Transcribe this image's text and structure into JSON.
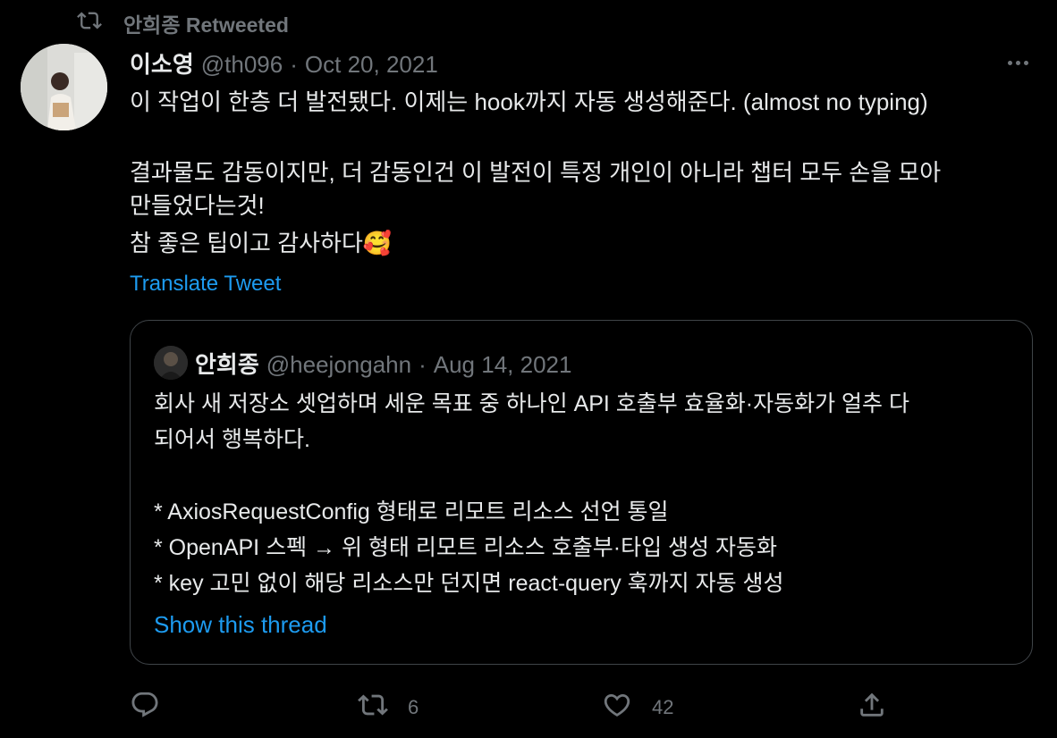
{
  "retweet_context": {
    "label": "안희종 Retweeted",
    "icon": "retweet-icon"
  },
  "tweet": {
    "display_name": "이소영",
    "handle": "@th096",
    "separator": "·",
    "date": "Oct 20, 2021",
    "line1": "이 작업이 한층 더 발전됐다. 이제는 hook까지 자동 생성해준다. (almost no typing)",
    "para2": "결과물도 감동이지만, 더 감동인건 이 발전이 특정 개인이 아니라 챕터 모두 손을 모아\n만들었다는것!",
    "line3": "참 좋은 팁이고 감사하다",
    "emoji": "🥰",
    "translate_label": "Translate Tweet"
  },
  "quoted_tweet": {
    "display_name": "안희종",
    "handle": "@heejongahn",
    "separator": "·",
    "date": "Aug 14, 2021",
    "para1": "회사 새 저장소 셋업하며 세운 목표 중 하나인 API 호출부 효율화·자동화가 얼추 다\n되어서 행복하다.",
    "bullet1": "* AxiosRequestConfig 형태로 리모트 리소스 선언 통일",
    "bullet2": "* OpenAPI 스펙 → 위 형태 리모트 리소스 호출부·타입 생성 자동화",
    "bullet3": "* key 고민 없이 해당 리소스만 던지면 react-query 훅까지 자동 생성",
    "show_thread_label": "Show this thread"
  },
  "actions": {
    "reply": {
      "icon": "reply-icon",
      "count": ""
    },
    "retweet": {
      "icon": "retweet-icon",
      "count": "6"
    },
    "like": {
      "icon": "heart-icon",
      "count": "42"
    },
    "share": {
      "icon": "share-icon"
    }
  },
  "colors": {
    "background": "#000000",
    "text": "#e7e9ea",
    "muted": "#71767b",
    "link": "#1d9bf0",
    "border": "#3f4448"
  }
}
